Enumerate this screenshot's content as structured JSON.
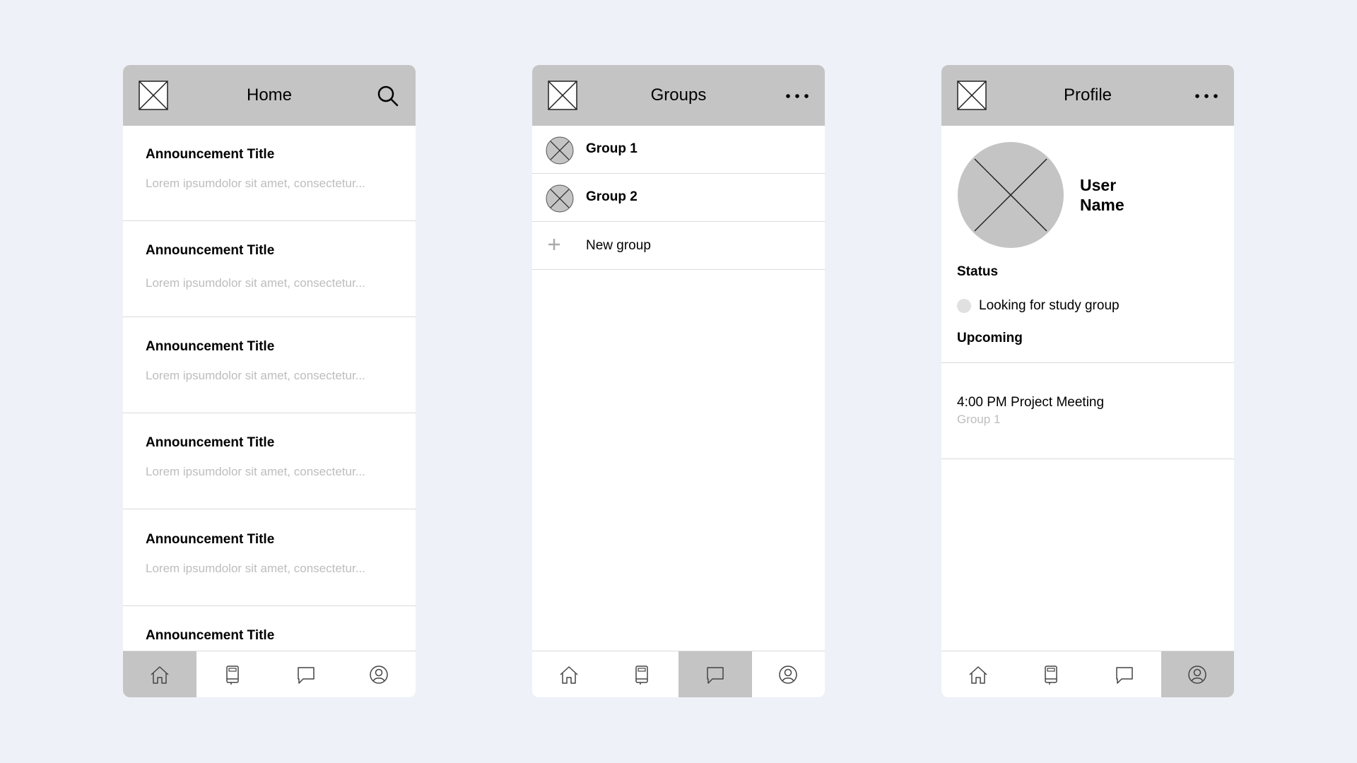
{
  "home": {
    "title": "Home",
    "logo_icon": "image-placeholder-icon",
    "action_icon": "search-icon",
    "announcements": [
      {
        "title": "Announcement Title",
        "body": "Lorem ipsumdolor sit amet, consectetur..."
      },
      {
        "title": "Announcement Title",
        "body": "Lorem ipsumdolor sit amet, consectetur..."
      },
      {
        "title": "Announcement Title",
        "body": "Lorem ipsumdolor sit amet, consectetur..."
      },
      {
        "title": "Announcement Title",
        "body": "Lorem ipsumdolor sit amet, consectetur..."
      },
      {
        "title": "Announcement Title",
        "body": "Lorem ipsumdolor sit amet, consectetur..."
      },
      {
        "title": "Announcement Title",
        "body": ""
      }
    ],
    "active_nav": "home"
  },
  "groups": {
    "title": "Groups",
    "logo_icon": "image-placeholder-icon",
    "action_icon": "more-icon",
    "items": [
      {
        "label": "Group 1"
      },
      {
        "label": "Group 2"
      }
    ],
    "new_group_label": "New group",
    "active_nav": "chat"
  },
  "profile": {
    "title": "Profile",
    "logo_icon": "image-placeholder-icon",
    "action_icon": "more-icon",
    "user_name_line1": "User",
    "user_name_line2": "Name",
    "status_heading": "Status",
    "status_text": "Looking for study group",
    "upcoming_heading": "Upcoming",
    "event_title": "4:00 PM Project Meeting",
    "event_group": "Group 1",
    "active_nav": "profile"
  },
  "nav": {
    "items": [
      "home-icon",
      "book-icon",
      "chat-icon",
      "profile-icon"
    ]
  },
  "colors": {
    "page_background": "#eef1f8",
    "header_background": "#c4c4c4",
    "muted_text": "#bdbdbd",
    "divider": "#dadada"
  }
}
